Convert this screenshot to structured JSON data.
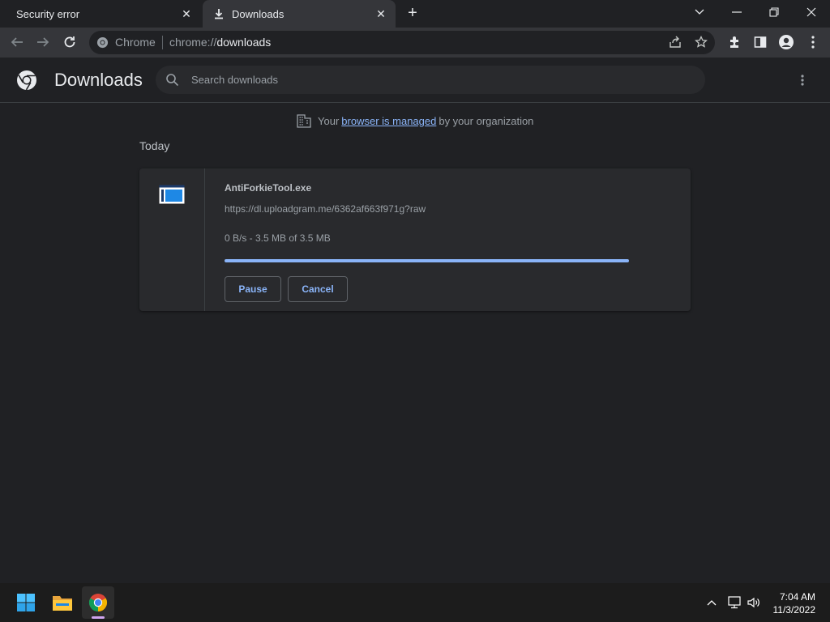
{
  "tabs": [
    {
      "title": "Security error"
    },
    {
      "title": "Downloads"
    }
  ],
  "toolbar": {
    "omnibox_scheme": "Chrome",
    "omnibox_url_prefix": "chrome://",
    "omnibox_url_host": "downloads"
  },
  "page": {
    "title": "Downloads",
    "search_placeholder": "Search downloads",
    "managed_prefix": "Your",
    "managed_link": "browser is managed",
    "managed_suffix": "by your organization",
    "section_label": "Today"
  },
  "download": {
    "file_name": "AntiForkieTool.exe",
    "url": "https://dl.uploadgram.me/6362af663f971g?raw",
    "status": "0 B/s - 3.5 MB of 3.5 MB",
    "progress_percent": 100,
    "pause_label": "Pause",
    "cancel_label": "Cancel"
  },
  "taskbar": {
    "time": "7:04 AM",
    "date": "11/3/2022"
  },
  "colors": {
    "accent": "#8ab4f8",
    "background": "#202124",
    "card": "#292a2d",
    "toolbar": "#35363a"
  },
  "icons": [
    "download-icon",
    "close-icon",
    "plus-icon",
    "chevron-down-icon",
    "minimize-icon",
    "restore-icon",
    "back-icon",
    "forward-icon",
    "reload-icon",
    "share-icon",
    "star-icon",
    "extensions-icon",
    "side-panel-icon",
    "profile-icon",
    "more-vert-icon",
    "chrome-logo-icon",
    "search-icon",
    "building-icon",
    "exe-file-icon",
    "windows-start-icon",
    "file-explorer-icon",
    "chrome-app-icon",
    "chevron-up-icon",
    "network-icon",
    "volume-icon"
  ]
}
